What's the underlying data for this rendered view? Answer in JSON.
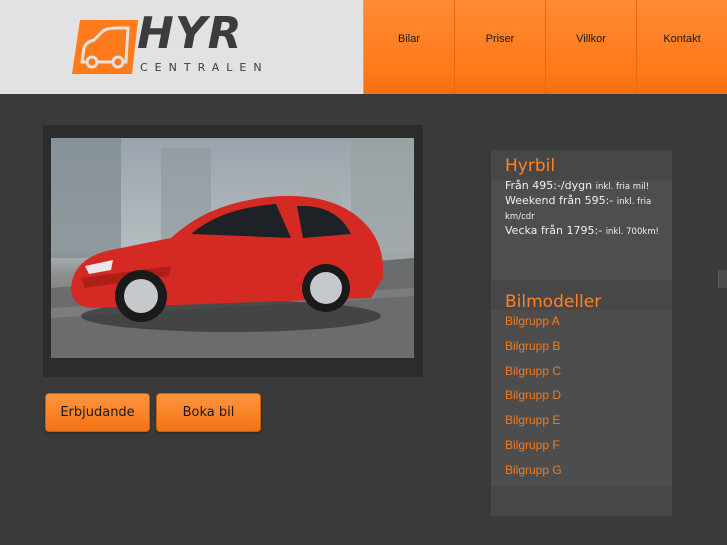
{
  "logo": {
    "word": "HYR",
    "sub": "CENTRALEN"
  },
  "nav": {
    "items": [
      "Bilar",
      "Priser",
      "Villkor",
      "Kontakt"
    ]
  },
  "buttons": {
    "offers": "Erbjudande",
    "book": "Boka bil"
  },
  "hyrbil": {
    "title": "Hyrbil",
    "lines": [
      {
        "main": "Från 495:-/dygn",
        "note": "inkl. fria mil!"
      },
      {
        "main": "Weekend från 595:-",
        "note": "inkl. fria km/cdr"
      },
      {
        "main": "Vecka från 1795:-",
        "note": "inkl. 700km!"
      }
    ]
  },
  "models": {
    "title": "Bilmodeller",
    "groups": [
      "Bilgrupp A",
      "Bilgrupp B",
      "Bilgrupp C",
      "Bilgrupp D",
      "Bilgrupp E",
      "Bilgrupp F",
      "Bilgrupp G"
    ]
  },
  "colors": {
    "accent": "#ff7a1a",
    "background": "#3a3a3a",
    "header": "#e2e2e2",
    "link": "#f07a20"
  },
  "icons": {
    "logo": "van-icon"
  }
}
